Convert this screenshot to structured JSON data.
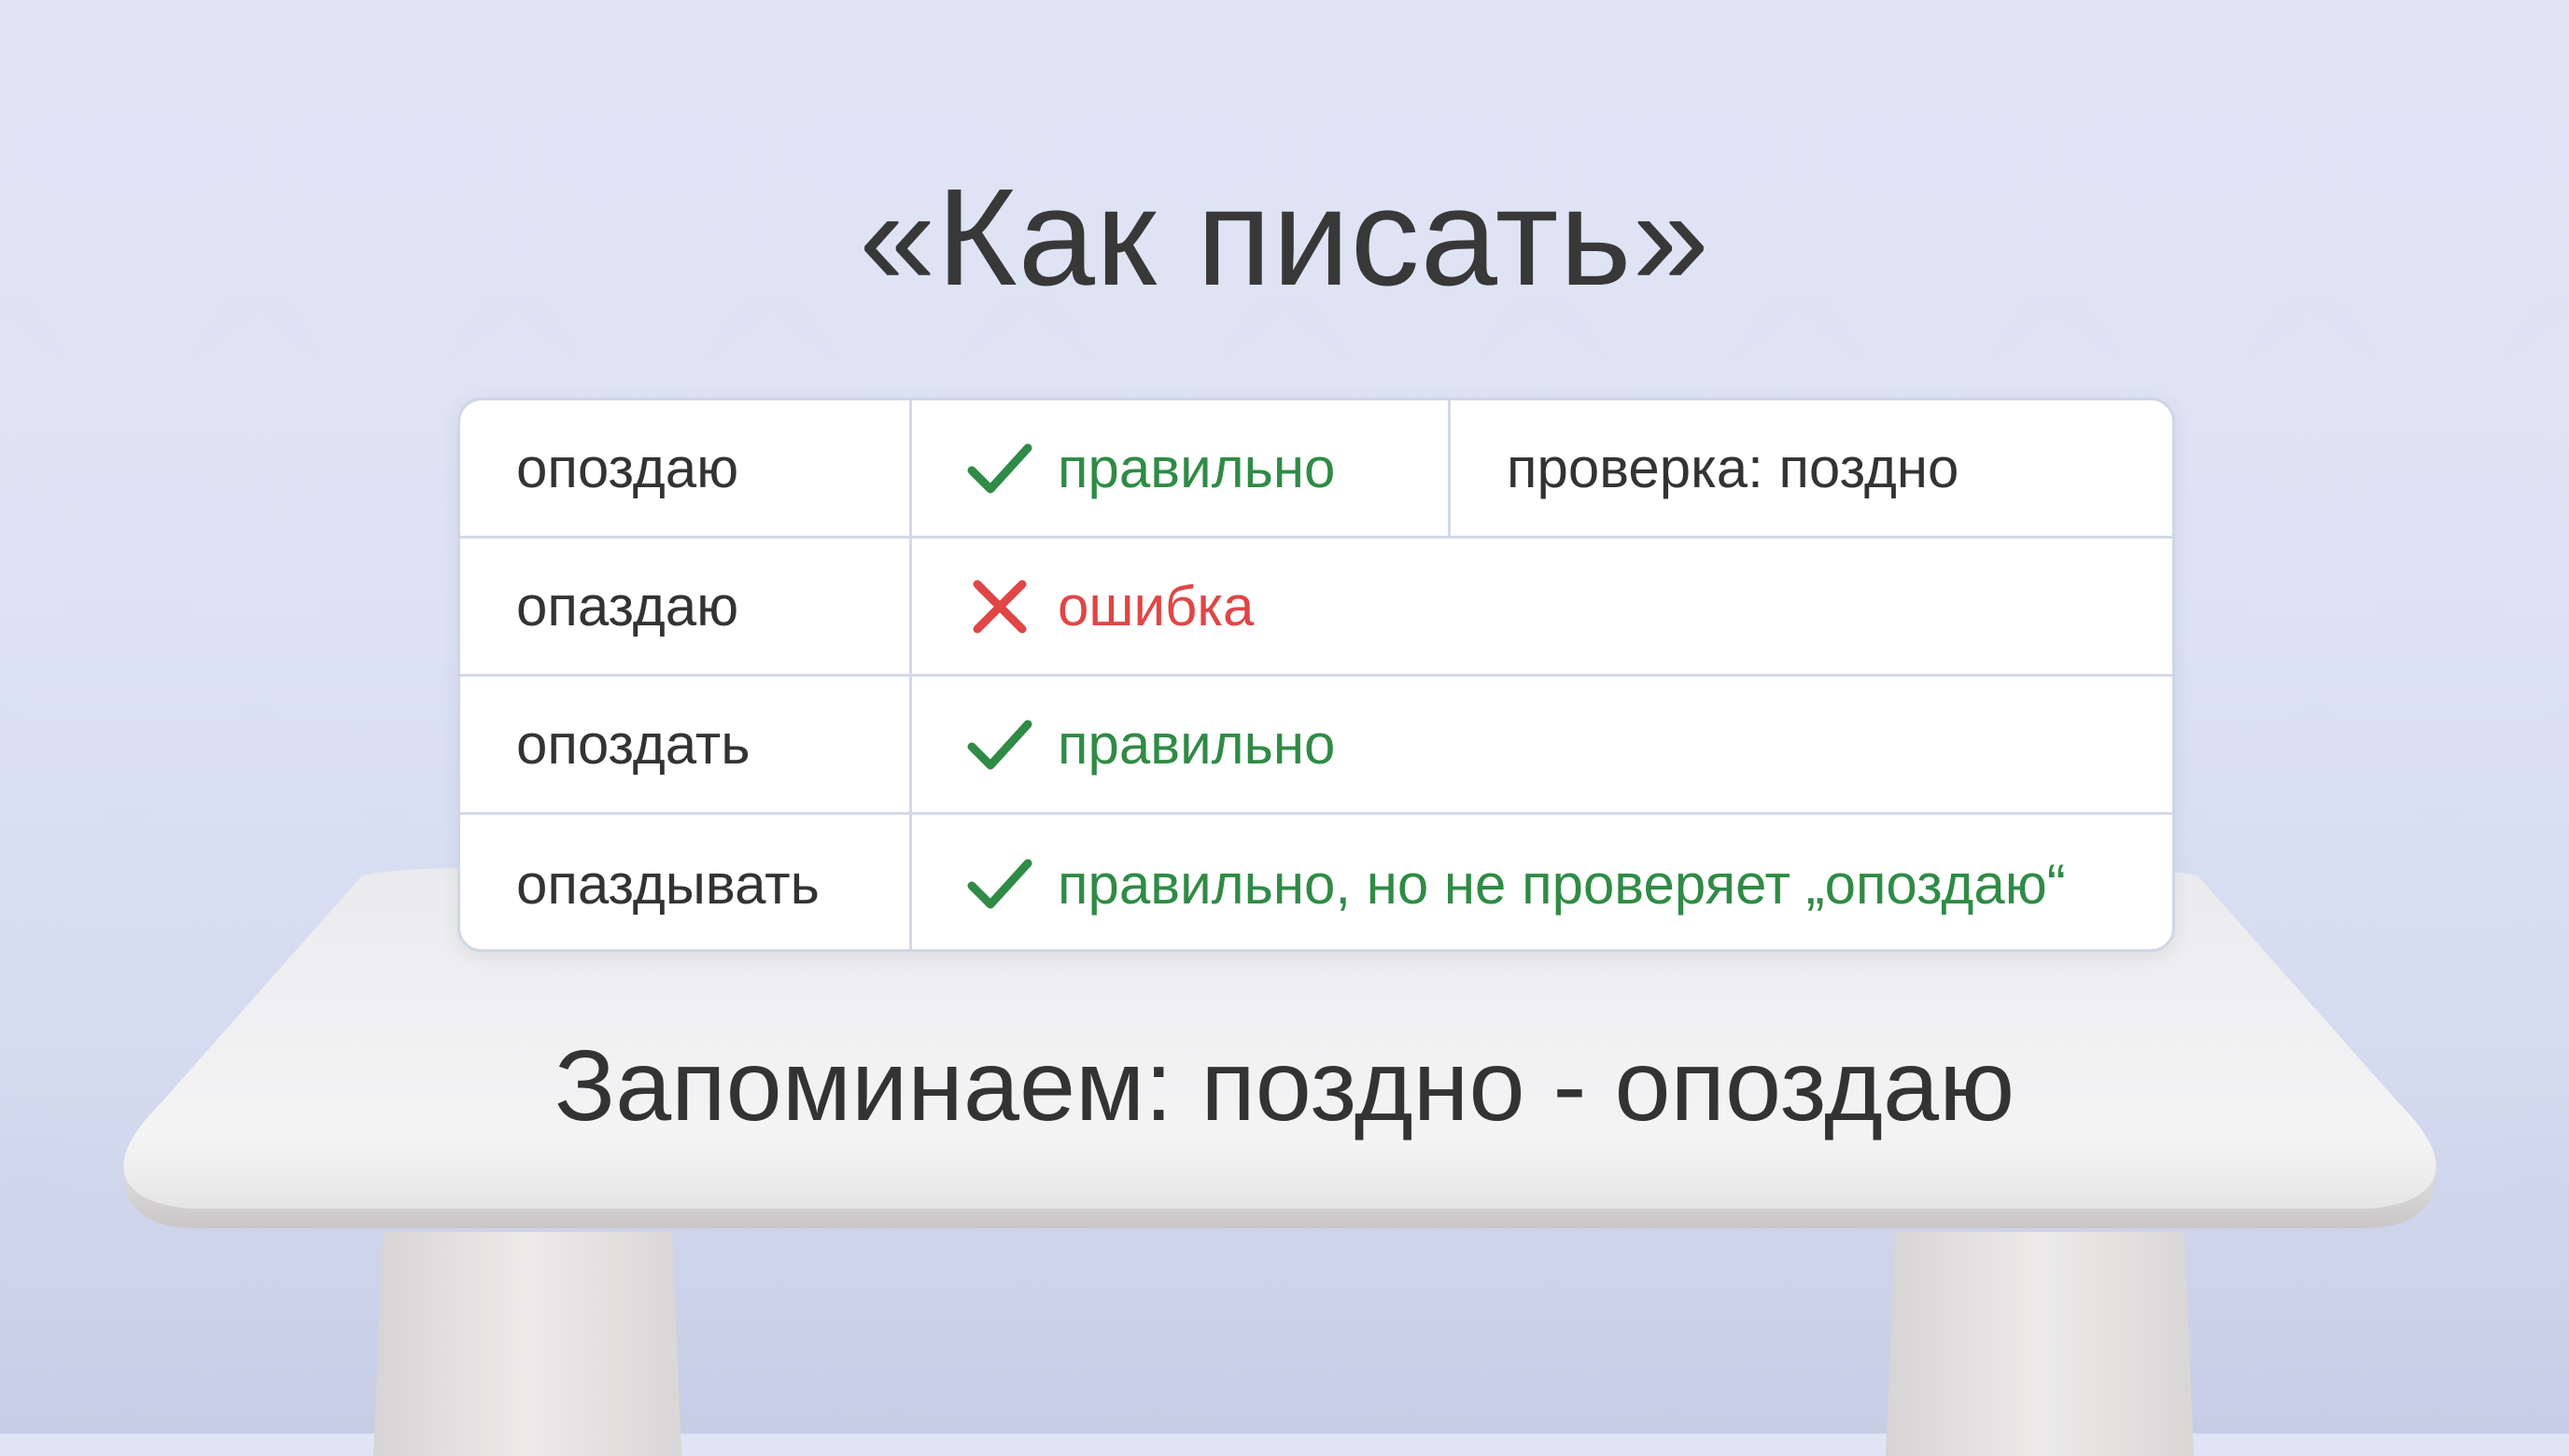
{
  "title": "«Как писать»",
  "table": {
    "rows": [
      {
        "word": "опоздаю",
        "status": "правильно",
        "status_type": "ok",
        "check": "проверка: поздно"
      },
      {
        "word": "опаздаю",
        "status": "ошибка",
        "status_type": "error"
      },
      {
        "word": "опоздать",
        "status": "правильно",
        "status_type": "ok"
      },
      {
        "word": "опаздывать",
        "status": "правильно, но не проверяет „опоздаю“",
        "status_type": "ok"
      }
    ]
  },
  "footer": "Запоминаем: поздно - опоздаю",
  "colors": {
    "ok": "#2f8b45",
    "error": "#e04646",
    "text": "#333333"
  },
  "icons": {
    "ok": "checkmark-icon",
    "error": "cross-icon"
  }
}
